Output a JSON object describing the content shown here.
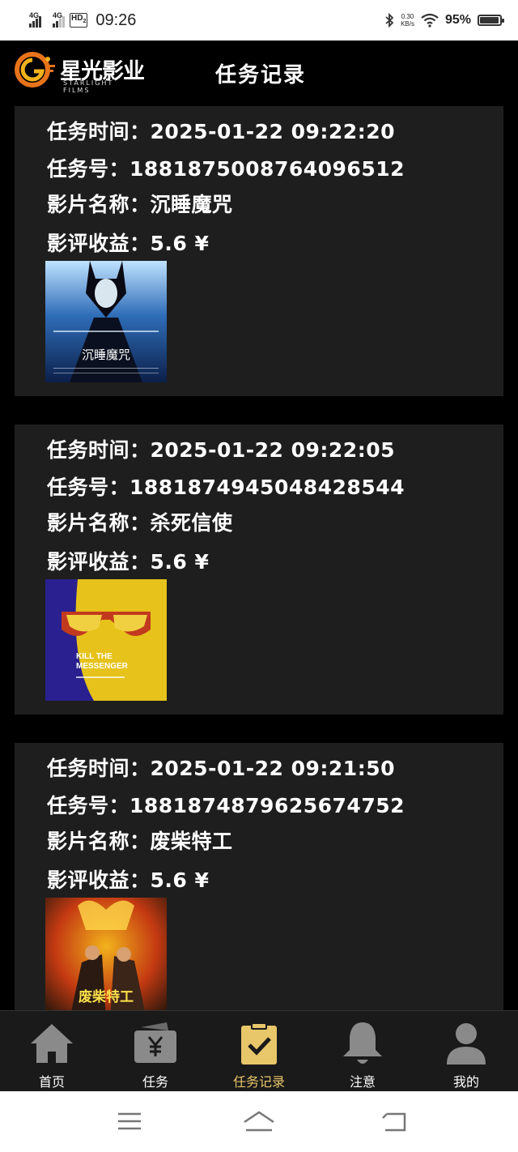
{
  "status": {
    "net1": "4G",
    "net2": "4G",
    "hd": "HD",
    "hd_sub": "2",
    "time": "09:26",
    "speed_value": "0.30",
    "speed_unit": "KB/s",
    "battery_text": "95%",
    "battery_level": 0.95
  },
  "header": {
    "logo_text": "星光影业",
    "logo_sub": "STARLIGHT FILMS",
    "title": "任务记录"
  },
  "records": [
    {
      "time_label": "任务时间：2025-01-22 09:22:20",
      "id_label": "任务号：1881875008764096512",
      "film_label": "影片名称：沉睡魔咒",
      "income_label": "影评收益：5.6 ¥",
      "poster_caption": "沉睡魔咒",
      "poster_colors": [
        "#0c1f4a",
        "#2f6db8",
        "#bfe2ff"
      ]
    },
    {
      "time_label": "任务时间：2025-01-22 09:22:05",
      "id_label": "任务号：1881874945048428544",
      "film_label": "影片名称：杀死信使",
      "income_label": "影评收益：5.6 ¥",
      "poster_caption": "KILL THE MESSENGER",
      "poster_colors": [
        "#2a2090",
        "#e6c21a",
        "#c23a1e"
      ]
    },
    {
      "time_label": "任务时间：2025-01-22 09:21:50",
      "id_label": "任务号：1881874879625674752",
      "film_label": "影片名称：废柴特工",
      "income_label": "影评收益：5.6 ¥",
      "poster_caption": "废柴特工",
      "poster_colors": [
        "#c43a12",
        "#f2b31c",
        "#3a1a0c"
      ]
    }
  ],
  "nav": {
    "items": [
      {
        "label": "首页",
        "icon": "home-icon"
      },
      {
        "label": "任务",
        "icon": "wallet-yen-icon"
      },
      {
        "label": "任务记录",
        "icon": "clipboard-check-icon"
      },
      {
        "label": "注意",
        "icon": "bell-icon"
      },
      {
        "label": "我的",
        "icon": "user-icon"
      }
    ],
    "active_index": 2,
    "active_color": "#e8c66a",
    "inactive_color": "#8a8a8a"
  }
}
